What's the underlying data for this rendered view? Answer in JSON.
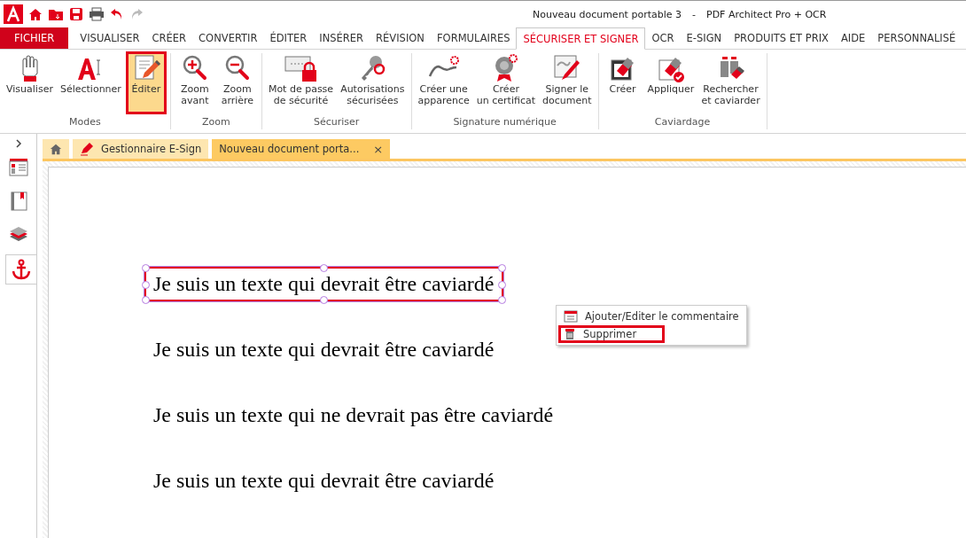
{
  "window": {
    "title": "Nouveau document portable 3",
    "separator": "-",
    "app": "PDF Architect Pro + OCR"
  },
  "menu_tabs": [
    {
      "label": "FICHIER",
      "kind": "file",
      "selected": false
    },
    {
      "label": "VISUALISER",
      "kind": "tab",
      "selected": false
    },
    {
      "label": "CRÉER",
      "kind": "tab",
      "selected": false
    },
    {
      "label": "CONVERTIR",
      "kind": "tab",
      "selected": false
    },
    {
      "label": "ÉDITER",
      "kind": "tab",
      "selected": false
    },
    {
      "label": "INSÉRER",
      "kind": "tab",
      "selected": false
    },
    {
      "label": "RÉVISION",
      "kind": "tab",
      "selected": false
    },
    {
      "label": "FORMULAIRES",
      "kind": "tab",
      "selected": false
    },
    {
      "label": "SÉCURISER ET SIGNER",
      "kind": "tab",
      "selected": true
    },
    {
      "label": "OCR",
      "kind": "tab",
      "selected": false
    },
    {
      "label": "E-SIGN",
      "kind": "tab",
      "selected": false
    },
    {
      "label": "PRODUITS ET PRIX",
      "kind": "tab",
      "selected": false
    },
    {
      "label": "AIDE",
      "kind": "tab",
      "selected": false
    },
    {
      "label": "PERSONNALISÉ",
      "kind": "tab",
      "selected": false
    }
  ],
  "ribbon_groups": [
    {
      "label": "Modes",
      "buttons": [
        {
          "label": "Visualiser",
          "kind": "hand",
          "selected": false,
          "highlighted": false
        },
        {
          "label": "Sélectionner",
          "kind": "select",
          "selected": false,
          "highlighted": false
        },
        {
          "label": "Éditer",
          "kind": "edit",
          "selected": true,
          "highlighted": true
        }
      ]
    },
    {
      "label": "Zoom",
      "buttons": [
        {
          "label": "Zoom\navant",
          "kind": "zoom-in",
          "selected": false,
          "highlighted": false
        },
        {
          "label": "Zoom\narrière",
          "kind": "zoom-out",
          "selected": false,
          "highlighted": false
        }
      ]
    },
    {
      "label": "Sécuriser",
      "buttons": [
        {
          "label": "Mot de passe\nde sécurité",
          "kind": "password",
          "selected": false,
          "highlighted": false
        },
        {
          "label": "Autorisations\nsécurisées",
          "kind": "key",
          "selected": false,
          "highlighted": false
        }
      ]
    },
    {
      "label": "Signature numérique",
      "buttons": [
        {
          "label": "Créer une\napparence",
          "kind": "sign",
          "selected": false,
          "highlighted": false
        },
        {
          "label": "Créer\nun certificat",
          "kind": "certificate",
          "selected": false,
          "highlighted": false
        },
        {
          "label": "Signer le\ndocument",
          "kind": "sign-doc",
          "selected": false,
          "highlighted": false
        }
      ]
    },
    {
      "label": "Caviardage",
      "buttons": [
        {
          "label": "Créer",
          "kind": "eraser",
          "selected": false,
          "highlighted": false
        },
        {
          "label": "Appliquer",
          "kind": "eraser-check",
          "selected": false,
          "highlighted": false
        },
        {
          "label": "Rechercher\net caviarder",
          "kind": "binoculars",
          "selected": false,
          "highlighted": false
        }
      ]
    }
  ],
  "sidebar": {
    "items": [
      {
        "kind": "panel",
        "selected": false
      },
      {
        "kind": "bookmark",
        "selected": false
      },
      {
        "kind": "layers",
        "selected": false
      },
      {
        "kind": "anchor",
        "selected": true
      }
    ]
  },
  "doc_tabs": [
    {
      "label": "Gestionnaire E-Sign",
      "selected": false,
      "closable": false
    },
    {
      "label": "Nouveau document porta...",
      "selected": true,
      "closable": true
    }
  ],
  "close_glyph": "×",
  "document": {
    "lines": [
      {
        "text": "Je suis un texte qui devrait être caviardé",
        "selected": true
      },
      {
        "text": "Je suis un texte qui devrait être caviardé",
        "selected": false
      },
      {
        "text": "Je suis un texte qui ne devrait pas être caviardé",
        "selected": false
      },
      {
        "text": "Je suis un texte qui devrait être caviardé",
        "selected": false
      }
    ]
  },
  "context_menu": {
    "items": [
      {
        "label": "Ajouter/Editer le commentaire",
        "kind": "comment",
        "highlighted": false
      },
      {
        "label": "Supprimer",
        "kind": "delete",
        "highlighted": true
      }
    ]
  }
}
